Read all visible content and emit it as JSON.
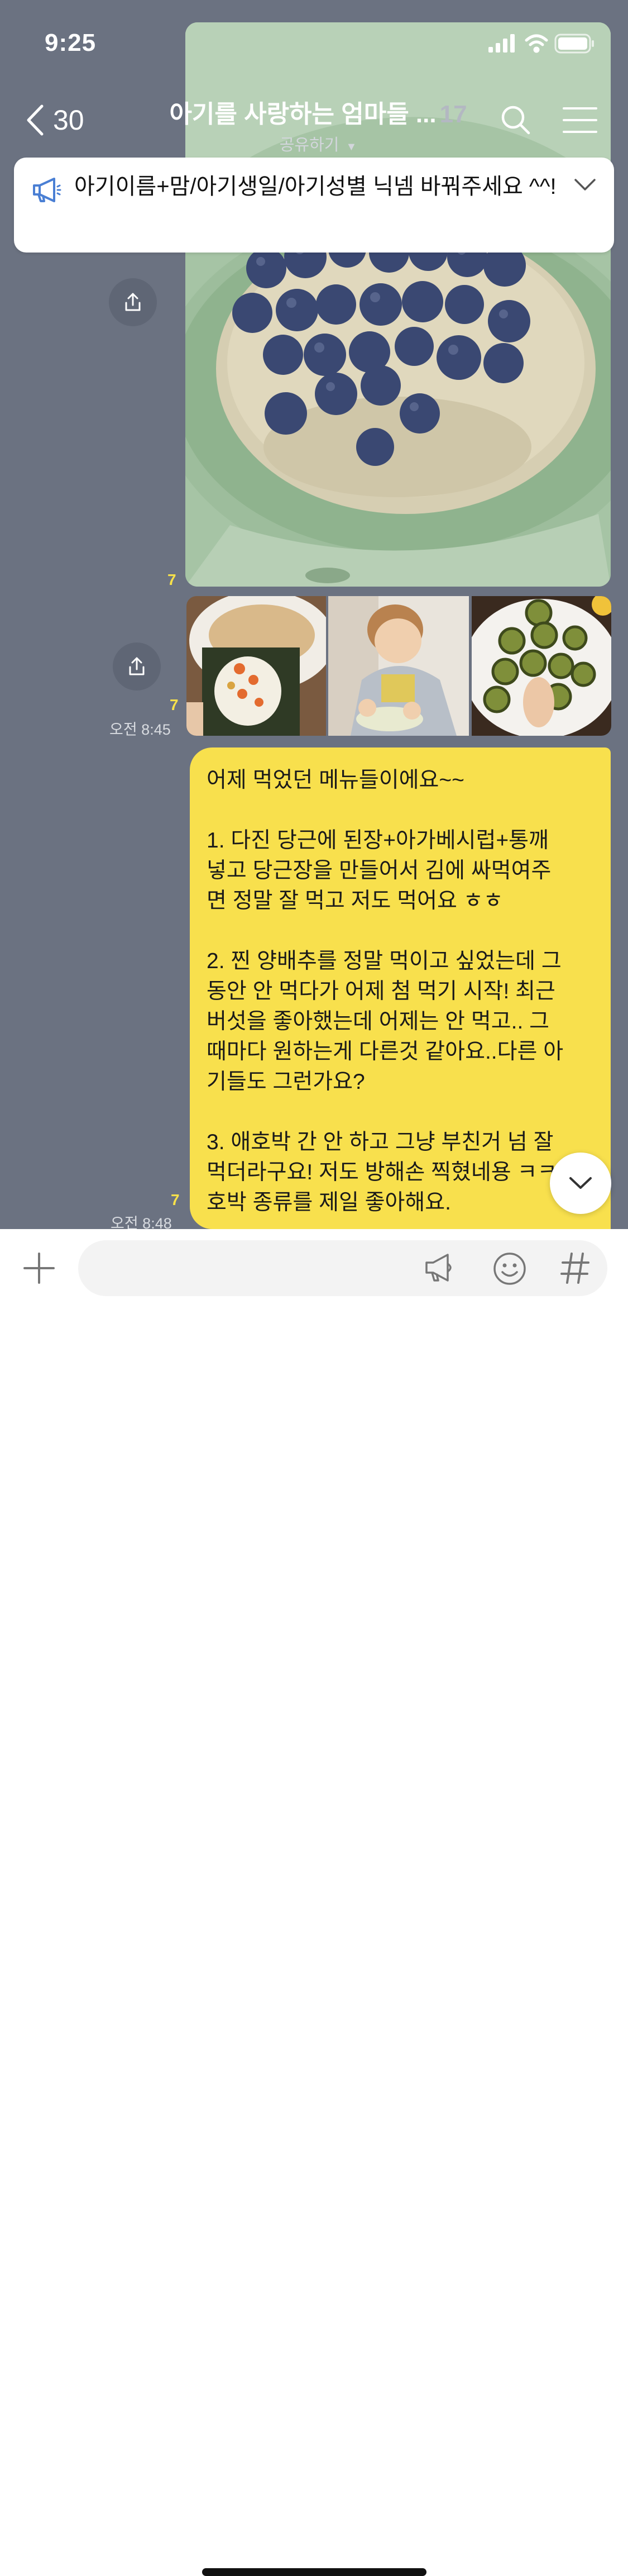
{
  "status": {
    "time": "9:25",
    "icons": [
      "signal-icon",
      "wifi-icon",
      "battery-icon"
    ]
  },
  "nav": {
    "back_count": "30",
    "title": "아기를 사랑하는 엄마들 ...",
    "member_count": "17",
    "share_label": "공유하기"
  },
  "notice": {
    "text": "아기이름+맘/아기생일/아기성별 닉넴 바꿔주세요 ^^!"
  },
  "messages": {
    "photo1": {
      "read_count": "7"
    },
    "album": {
      "read_count": "7",
      "time": "오전 8:45"
    },
    "text_msg": {
      "read_count": "7",
      "time": "오전 8:48",
      "lines": [
        "어제 먹었던 메뉴들이에요~~",
        "",
        "1. 다진 당근에 된장+아가베시럽+통깨",
        "넣고 당근장을 만들어서 김에 싸먹여주",
        "면 정말 잘 먹고 저도 먹어요 ㅎㅎ",
        "",
        "2. 찐 양배추를 정말 먹이고 싶었는데 그",
        "동안 안 먹다가 어제 첨 먹기 시작! 최근",
        "버섯을 좋아했는데 어제는 안 먹고.. 그",
        "때마다 원하는게 다른것 같아요..다른 아",
        "기들도 그런가요?",
        "",
        "3. 애호박 간 안 하고 그냥 부친거 넘 잘",
        "먹더라구요! 저도 방해손 찍혔네용 ㅋㅋ",
        "호박 종류를 제일 좋아해요."
      ]
    }
  },
  "input": {
    "placeholder": "",
    "value": ""
  },
  "colors": {
    "chat_bg": "#6b7281",
    "bubble": "#f8e04d",
    "read_count": "#f7e14a",
    "notice_icon": "#4a7fd4"
  }
}
